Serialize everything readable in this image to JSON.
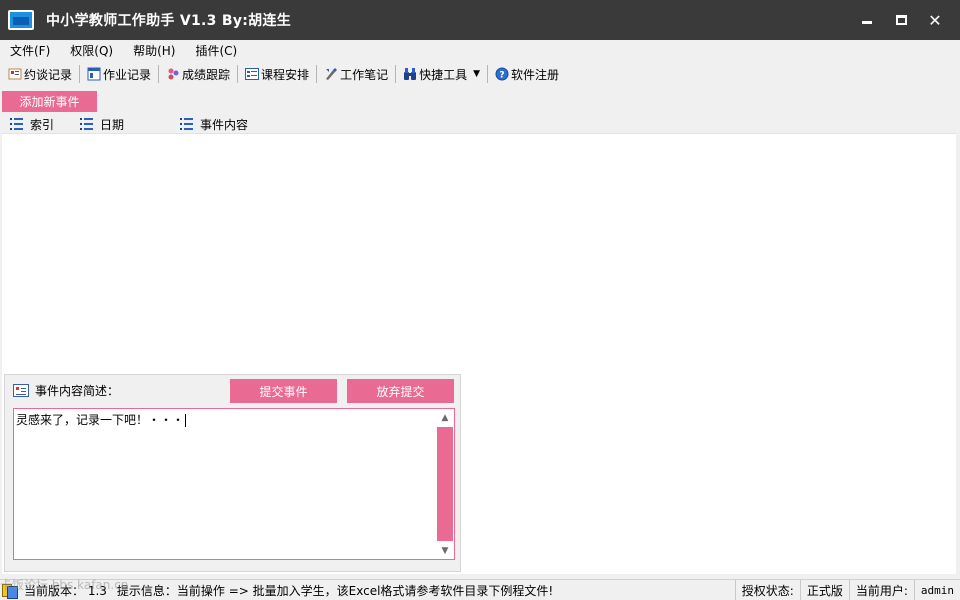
{
  "window": {
    "title": "中小学教师工作助手 V1.3  By:胡连生",
    "minimize_glyph": "",
    "close_glyph": "✕"
  },
  "menu": [
    "文件(F)",
    "权限(Q)",
    "帮助(H)",
    "插件(C)"
  ],
  "toolbar": {
    "items": [
      {
        "label": "约谈记录",
        "icon": "chat-record-icon"
      },
      {
        "label": "作业记录",
        "icon": "homework-record-icon"
      },
      {
        "label": "成绩跟踪",
        "icon": "score-track-icon"
      },
      {
        "label": "课程安排",
        "icon": "schedule-icon"
      },
      {
        "label": "工作笔记",
        "icon": "notes-icon"
      },
      {
        "label": "快捷工具",
        "icon": "binoculars-icon"
      },
      {
        "label": "软件注册",
        "icon": "help-icon"
      }
    ]
  },
  "add_event_button": "添加新事件",
  "list": {
    "columns": [
      "索引",
      "日期",
      "事件内容"
    ]
  },
  "description_panel": {
    "label": "事件内容简述：",
    "submit_button": "提交事件",
    "cancel_button": "放弃提交",
    "text_value": "灵感来了，记录一下吧！・・・"
  },
  "statusbar": {
    "version_text": "当前版本： 1.3",
    "tip_text": "提示信息：当前操作 => 批量加入学生，该Excel格式请参考软件目录下例程文件!",
    "auth_label": "授权状态:",
    "auth_value": "正式版",
    "user_label": "当前用户:",
    "user_value": "admin"
  },
  "watermark": "卡饭论坛 bbs.kafan.cn",
  "colors": {
    "accent": "#e96a93",
    "titlebar": "#3a3a3a"
  }
}
